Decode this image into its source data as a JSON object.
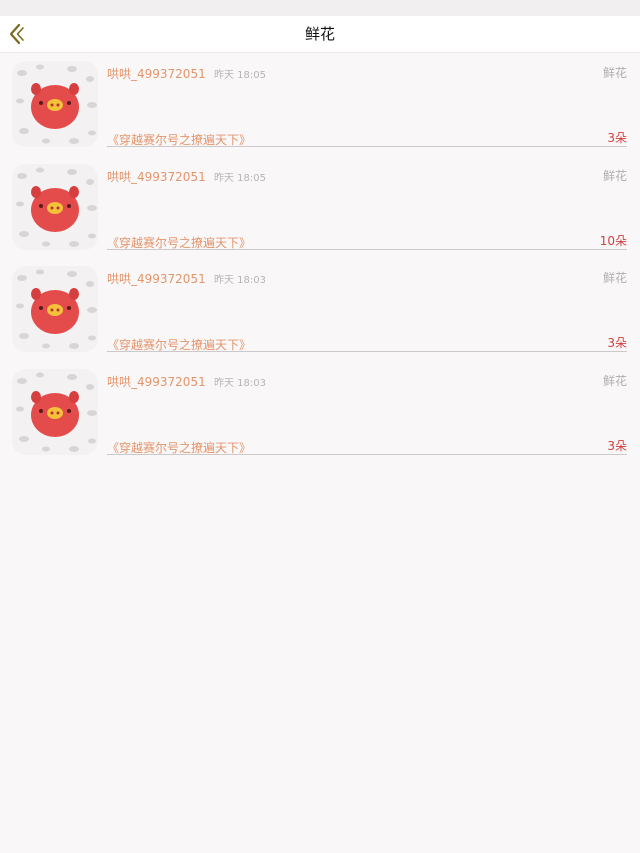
{
  "nav": {
    "title": "鲜花",
    "back_icon": "chevron-left-icon",
    "back_color": "#7a6a1e"
  },
  "records": [
    {
      "username": "哄哄_499372051",
      "time": "昨天 18:05",
      "kind": "鲜花",
      "book": "《穿越赛尔号之撩遍天下》",
      "count": "3朵"
    },
    {
      "username": "哄哄_499372051",
      "time": "昨天 18:05",
      "kind": "鲜花",
      "book": "《穿越赛尔号之撩遍天下》",
      "count": "10朵"
    },
    {
      "username": "哄哄_499372051",
      "time": "昨天 18:03",
      "kind": "鲜花",
      "book": "《穿越赛尔号之撩遍天下》",
      "count": "3朵"
    },
    {
      "username": "哄哄_499372051",
      "time": "昨天 18:03",
      "kind": "鲜花",
      "book": "《穿越赛尔号之撩遍天下》",
      "count": "3朵"
    }
  ],
  "colors": {
    "username": "#e3956b",
    "count": "#d0403f",
    "avatar_pig": "#e44c4c"
  }
}
